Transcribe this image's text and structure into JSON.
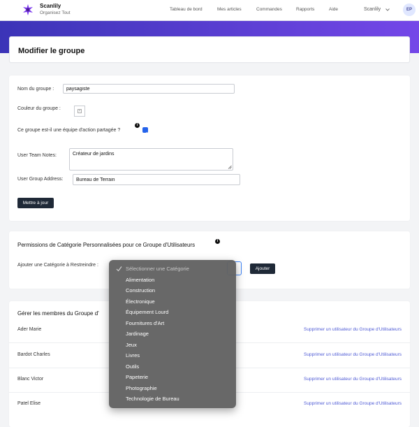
{
  "app": {
    "brand": "Scanlily",
    "tagline": "Organisez Tout",
    "account_name": "Scanlily",
    "avatar_initials": "EP"
  },
  "nav": {
    "dashboard": "Tableau de bord",
    "items": "Mes articles",
    "orders": "Commandes",
    "reports": "Rapports",
    "help": "Aide"
  },
  "page": {
    "title": "Modifier le groupe"
  },
  "form": {
    "name_label": "Nom du groupe :",
    "name_value": "paysagiste",
    "color_label": "Couleur du groupe :",
    "shared_label": "Ce groupe est-il une équipe d'action partagée ?",
    "shared_checked": true,
    "notes_label": "User Team Notes:",
    "notes_value": "Créateur de jardins",
    "address_label": "User Group Address:",
    "address_value": "Bureau de Terrain",
    "update_button": "Mettre à jour"
  },
  "permissions": {
    "title": "Permissions de Catégorie Personnalisées pour ce Groupe d'Utilisateurs",
    "add_label": "Ajouter une Catégorie à Restreindre :",
    "add_button": "Ajouter",
    "dropdown": {
      "placeholder": "Sélectionner une Catégorie",
      "options": [
        "Alimentation",
        "Construction",
        "Électronique",
        "Équipement Lourd",
        "Fournitures d'Art",
        "Jardinage",
        "Jeux",
        "Livres",
        "Outils",
        "Papeterie",
        "Photographie",
        "Technologie de Bureau"
      ]
    }
  },
  "members": {
    "title": "Gérer les membres du Groupe d'",
    "remove_label": "Supprimer un utilisateur du Groupe d'Utilisateurs",
    "list": [
      {
        "name": "Ader Marie"
      },
      {
        "name": "Bardot Charles"
      },
      {
        "name": "Blanc Victor"
      },
      {
        "name": "Patel Elise"
      }
    ]
  },
  "colors": {
    "accent": "#2563eb",
    "band_start": "#3b34b7",
    "band_end": "#7447e8",
    "link": "#4f5bd5",
    "button": "#1f2937"
  }
}
